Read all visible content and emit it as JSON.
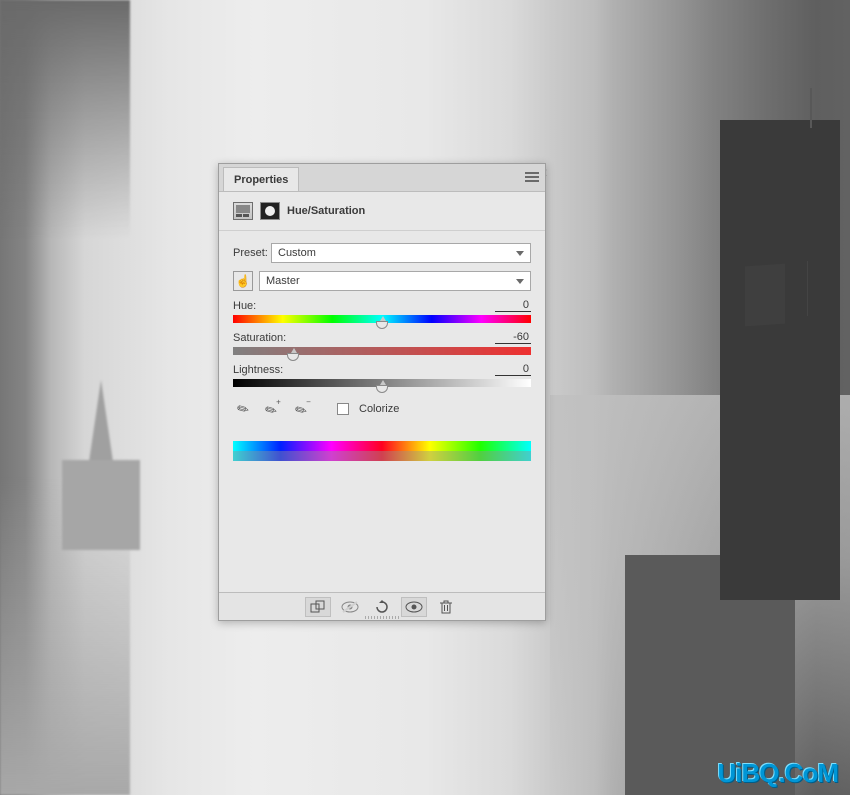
{
  "panel": {
    "tab_label": "Properties",
    "adjustment_name": "Hue/Saturation",
    "preset_label": "Preset:",
    "preset_value": "Custom",
    "channel_value": "Master",
    "sliders": {
      "hue_label": "Hue:",
      "hue_value": "0",
      "hue_position_pct": 50,
      "sat_label": "Saturation:",
      "sat_value": "-60",
      "sat_position_pct": 20,
      "light_label": "Lightness:",
      "light_value": "0",
      "light_position_pct": 50
    },
    "colorize_label": "Colorize"
  },
  "watermark": "UiBQ.CoM"
}
